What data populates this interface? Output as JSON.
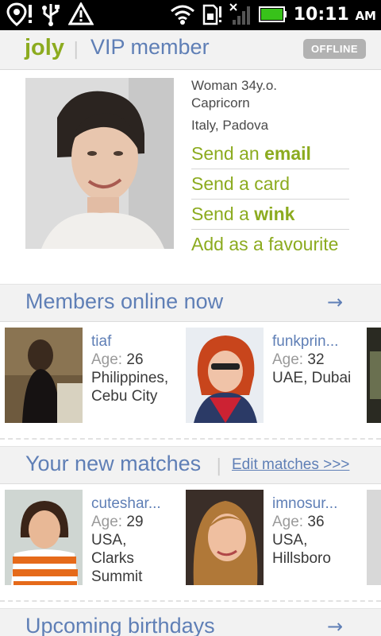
{
  "status_bar": {
    "time": "10:11",
    "ampm": "AM",
    "icons": [
      "location-pin-icon",
      "usb-icon",
      "warning-icon",
      "wifi-icon",
      "sd-card-icon",
      "no-signal-icon",
      "battery-icon"
    ]
  },
  "header": {
    "username": "joly",
    "separator": "|",
    "membership": "VIP member",
    "status": "OFFLINE"
  },
  "profile": {
    "gender_age": "Woman 34y.o.",
    "zodiac": "Capricorn",
    "location": "Italy, Padova",
    "actions": {
      "email_prefix": "Send an ",
      "email_bold": "email",
      "card": "Send a card",
      "wink_prefix": "Send a ",
      "wink_bold": "wink",
      "favourite": "Add as a favourite"
    }
  },
  "online_section": {
    "title": "Members online now",
    "arrow": "→",
    "members": [
      {
        "name": "tiaf",
        "age_label": "Age:",
        "age": "26",
        "location_1": "Philippines,",
        "location_2": "Cebu City",
        "location_3": ""
      },
      {
        "name": "funkprin...",
        "age_label": "Age:",
        "age": "32",
        "location_1": "UAE, Dubai",
        "location_2": "",
        "location_3": ""
      }
    ]
  },
  "matches_section": {
    "title": "Your new matches",
    "separator": "|",
    "edit_label": "Edit matches >>>",
    "members": [
      {
        "name": "cuteshar...",
        "age_label": "Age:",
        "age": "29",
        "location_1": "USA,",
        "location_2": "Clarks",
        "location_3": "Summit"
      },
      {
        "name": "imnosur...",
        "age_label": "Age:",
        "age": "36",
        "location_1": "USA,",
        "location_2": "Hillsboro",
        "location_3": ""
      }
    ]
  },
  "birthdays_section": {
    "title": "Upcoming birthdays",
    "arrow": "→"
  },
  "colors": {
    "accent_green": "#8cab1f",
    "link_blue": "#5f7fb6",
    "header_bg": "#f2f2f2",
    "badge_grey": "#b2b2b2"
  }
}
